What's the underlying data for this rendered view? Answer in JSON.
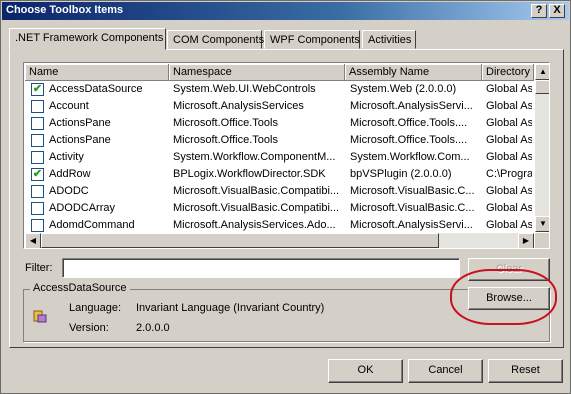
{
  "window": {
    "title": "Choose Toolbox Items",
    "help_button": "?",
    "close_button": "X"
  },
  "tabs": [
    {
      "label": ".NET Framework Components",
      "active": true
    },
    {
      "label": "COM Components"
    },
    {
      "label": "WPF Components"
    },
    {
      "label": "Activities"
    }
  ],
  "list": {
    "columns": [
      "Name",
      "Namespace",
      "Assembly Name",
      "Directory"
    ],
    "rows": [
      {
        "checked": true,
        "name": "AccessDataSource",
        "namespace": "System.Web.UI.WebControls",
        "assembly": "System.Web (2.0.0.0)",
        "directory": "Global Ass"
      },
      {
        "checked": false,
        "name": "Account",
        "namespace": "Microsoft.AnalysisServices",
        "assembly": "Microsoft.AnalysisServi...",
        "directory": "Global Ass"
      },
      {
        "checked": false,
        "name": "ActionsPane",
        "namespace": "Microsoft.Office.Tools",
        "assembly": "Microsoft.Office.Tools....",
        "directory": "Global Ass"
      },
      {
        "checked": false,
        "name": "ActionsPane",
        "namespace": "Microsoft.Office.Tools",
        "assembly": "Microsoft.Office.Tools....",
        "directory": "Global Ass"
      },
      {
        "checked": false,
        "name": "Activity",
        "namespace": "System.Workflow.ComponentM...",
        "assembly": "System.Workflow.Com...",
        "directory": "Global Ass"
      },
      {
        "checked": true,
        "name": "AddRow",
        "namespace": "BPLogix.WorkflowDirector.SDK",
        "assembly": "bpVSPlugin (2.0.0.0)",
        "directory": "C:\\Progra"
      },
      {
        "checked": false,
        "name": "ADODC",
        "namespace": "Microsoft.VisualBasic.Compatibi...",
        "assembly": "Microsoft.VisualBasic.C...",
        "directory": "Global Ass"
      },
      {
        "checked": false,
        "name": "ADODCArray",
        "namespace": "Microsoft.VisualBasic.Compatibi...",
        "assembly": "Microsoft.VisualBasic.C...",
        "directory": "Global Ass"
      },
      {
        "checked": false,
        "name": "AdomdCommand",
        "namespace": "Microsoft.AnalysisServices.Ado...",
        "assembly": "Microsoft.AnalysisServi...",
        "directory": "Global Ass"
      }
    ]
  },
  "filter": {
    "label": "Filter:",
    "value": "",
    "clear_label": "Clear"
  },
  "details": {
    "group_title": "AccessDataSource",
    "language_label": "Language:",
    "language_value": "Invariant Language (Invariant Country)",
    "version_label": "Version:",
    "version_value": "2.0.0.0",
    "browse_label": "Browse..."
  },
  "footer": {
    "ok_label": "OK",
    "cancel_label": "Cancel",
    "reset_label": "Reset"
  },
  "colors": {
    "titlebar_start": "#0a246a",
    "highlight_circle": "#c8101e",
    "check_mark": "#21a121"
  }
}
